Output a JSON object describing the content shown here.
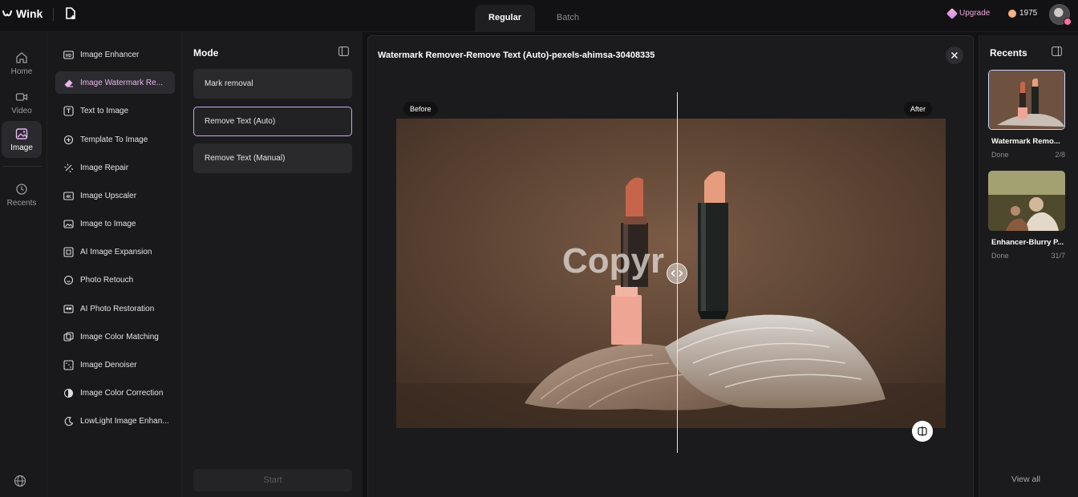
{
  "app": {
    "name": "Wink"
  },
  "header": {
    "tabs": [
      {
        "label": "Regular",
        "active": true
      },
      {
        "label": "Batch",
        "active": false
      }
    ],
    "upgrade_label": "Upgrade",
    "credits": "1975"
  },
  "rail": {
    "items": [
      {
        "label": "Home",
        "icon": "home-icon"
      },
      {
        "label": "Video",
        "icon": "video-icon"
      },
      {
        "label": "Image",
        "icon": "image-icon",
        "active": true
      },
      {
        "label": "Recents",
        "icon": "history-icon"
      }
    ]
  },
  "tools": [
    {
      "label": "Image Enhancer",
      "icon": "hd-icon"
    },
    {
      "label": "Image Watermark Re...",
      "icon": "eraser-icon",
      "active": true
    },
    {
      "label": "Text to Image",
      "icon": "text-image-icon"
    },
    {
      "label": "Template To Image",
      "icon": "template-icon"
    },
    {
      "label": "Image Repair",
      "icon": "repair-icon"
    },
    {
      "label": "Image Upscaler",
      "icon": "4k-icon"
    },
    {
      "label": "Image to Image",
      "icon": "image-to-image-icon"
    },
    {
      "label": "AI Image Expansion",
      "icon": "expand-icon"
    },
    {
      "label": "Photo Retouch",
      "icon": "retouch-icon"
    },
    {
      "label": "AI Photo Restoration",
      "icon": "restoration-icon"
    },
    {
      "label": "Image Color Matching",
      "icon": "color-match-icon"
    },
    {
      "label": "Image Denoiser",
      "icon": "denoise-icon"
    },
    {
      "label": "Image Color Correction",
      "icon": "color-correction-icon"
    },
    {
      "label": "LowLight Image Enhan...",
      "icon": "lowlight-icon"
    }
  ],
  "mode": {
    "title": "Mode",
    "options": [
      {
        "label": "Mark removal"
      },
      {
        "label": "Remove Text (Auto)",
        "selected": true
      },
      {
        "label": "Remove Text (Manual)"
      }
    ],
    "start_label": "Start"
  },
  "editor": {
    "title": "Watermark Remover-Remove Text (Auto)-pexels-ahimsa-30408335",
    "before_label": "Before",
    "after_label": "After",
    "watermark_text": "Copyr"
  },
  "recents": {
    "title": "Recents",
    "items": [
      {
        "name": "Watermark Remo...",
        "status": "Done",
        "count": "2/8"
      },
      {
        "name": "Enhancer-Blurry P...",
        "status": "Done",
        "count": "31/7"
      }
    ],
    "view_all_label": "View all"
  },
  "colors": {
    "accent": "#c9a6f0",
    "upgrade": "#e9a8d9",
    "background": "#121214"
  }
}
